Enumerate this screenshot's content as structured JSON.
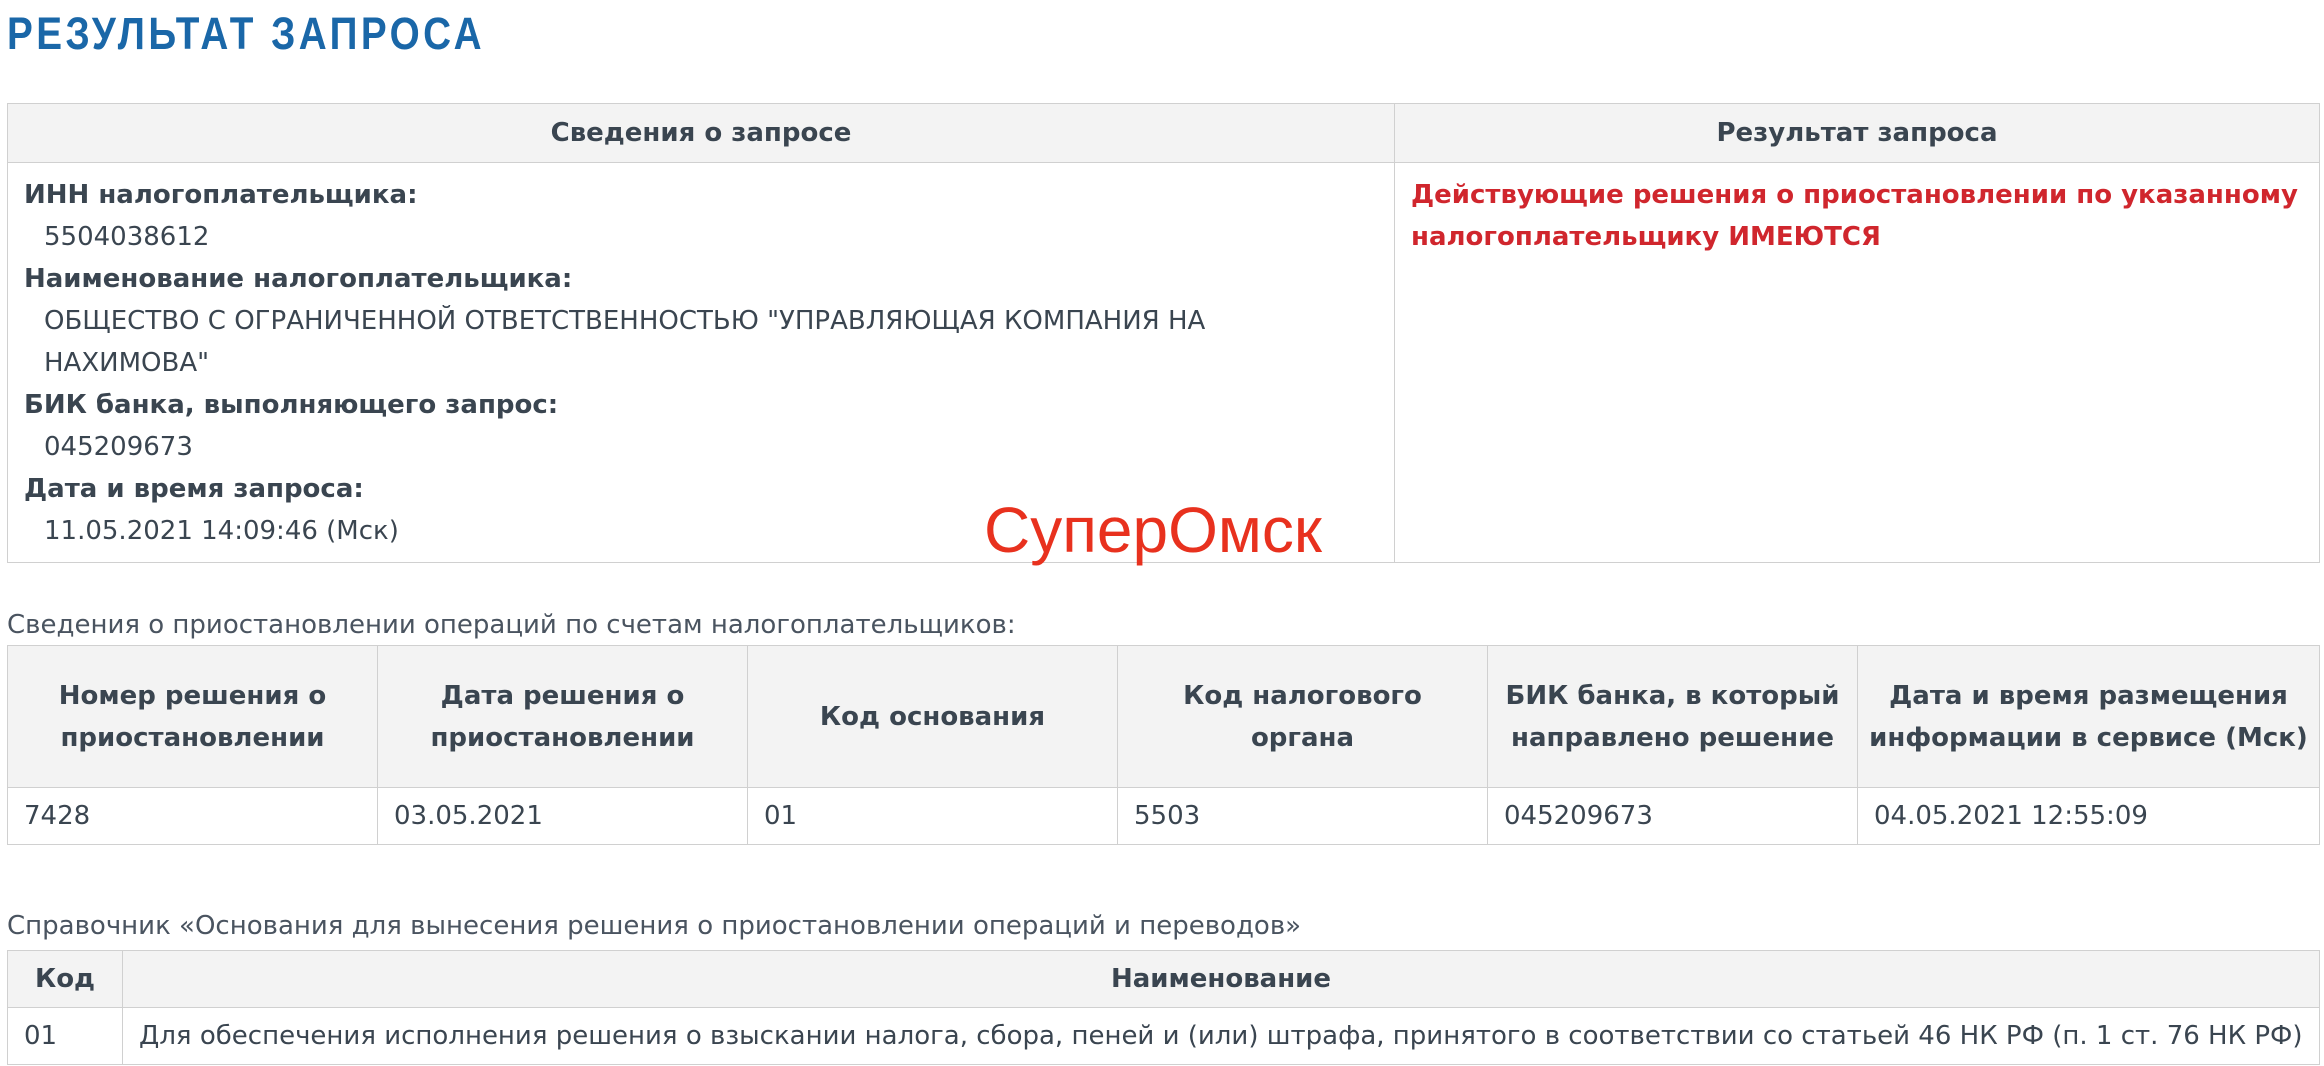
{
  "page": {
    "title": "РЕЗУЛЬТАТ ЗАПРОСА"
  },
  "request_table": {
    "headers": {
      "info": "Сведения о запросе",
      "result": "Результат запроса"
    },
    "fields": [
      {
        "label": "ИНН налогоплательщика:",
        "value": "5504038612"
      },
      {
        "label": "Наименование налогоплательщика:",
        "value": "ОБЩЕСТВО С ОГРАНИЧЕННОЙ ОТВЕТСТВЕННОСТЬЮ \"УПРАВЛЯЮЩАЯ КОМПАНИЯ НА НАХИМОВА\""
      },
      {
        "label": "БИК банка, выполняющего запрос:",
        "value": "045209673"
      },
      {
        "label": "Дата и время запроса:",
        "value": "11.05.2021 14:09:46 (Мск)"
      }
    ],
    "result_text": "Действующие решения о приостановлении по указанному налогоплательщику ИМЕЮТСЯ",
    "result_color": "#d0262d"
  },
  "watermark": {
    "text": "СуперОмск",
    "color": "#e8311e"
  },
  "suspension": {
    "caption": "Сведения о приостановлении операций по счетам налогоплательщиков:",
    "headers": [
      "Номер решения о приостановлении",
      "Дата решения о приостановлении",
      "Код основания",
      "Код налогового органа",
      "БИК банка, в который направлено решение",
      "Дата и время размещения информации в сервисе (Мск)"
    ],
    "rows": [
      [
        "7428",
        "03.05.2021",
        "01",
        "5503",
        "045209673",
        "04.05.2021 12:55:09"
      ]
    ]
  },
  "reference": {
    "caption": "Справочник «Основания для вынесения решения о приостановлении операций и переводов»",
    "headers": [
      "Код",
      "Наименование"
    ],
    "rows": [
      [
        "01",
        "Для обеспечения исполнения решения о взыскании налога, сбора, пеней и (или) штрафа, принятого в соответствии со статьей 46 НК РФ (п. 1 ст. 76 НК РФ)"
      ]
    ]
  },
  "colors": {
    "title": "#1a67a8",
    "header_bg": "#f3f3f3",
    "border": "#d0d0d0",
    "text": "#3a4550"
  }
}
